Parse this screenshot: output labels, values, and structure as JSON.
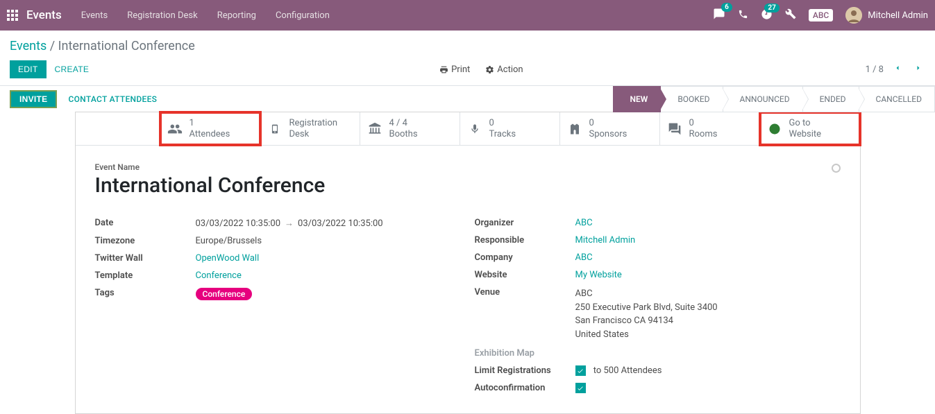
{
  "topbar": {
    "brand": "Events",
    "menu": [
      "Events",
      "Registration Desk",
      "Reporting",
      "Configuration"
    ],
    "msg_badge": "6",
    "activity_badge": "27",
    "company": "ABC",
    "user": "Mitchell Admin"
  },
  "breadcrumb": {
    "root": "Events",
    "current": "International Conference"
  },
  "actions": {
    "edit": "EDIT",
    "create": "CREATE",
    "print": "Print",
    "action": "Action"
  },
  "pager": {
    "pos": "1 / 8"
  },
  "statusbar": {
    "invite": "INVITE",
    "contact": "CONTACT ATTENDEES",
    "stages": [
      "NEW",
      "BOOKED",
      "ANNOUNCED",
      "ENDED",
      "CANCELLED"
    ]
  },
  "stats": {
    "attendees": {
      "n": "1",
      "label": "Attendees"
    },
    "regdesk": {
      "n": "",
      "label1": "Registration",
      "label2": "Desk"
    },
    "booths": {
      "n": "4 / 4",
      "label": "Booths"
    },
    "tracks": {
      "n": "0",
      "label": "Tracks"
    },
    "sponsors": {
      "n": "0",
      "label": "Sponsors"
    },
    "rooms": {
      "n": "0",
      "label": "Rooms"
    },
    "website": {
      "label1": "Go to",
      "label2": "Website"
    }
  },
  "form": {
    "name_label": "Event Name",
    "name": "International Conference",
    "date_label": "Date",
    "date_from": "03/03/2022 10:35:00",
    "date_to": "03/03/2022 10:35:00",
    "tz_label": "Timezone",
    "tz": "Europe/Brussels",
    "twitter_label": "Twitter Wall",
    "twitter": "OpenWood Wall",
    "template_label": "Template",
    "template": "Conference",
    "tags_label": "Tags",
    "tag": "Conference",
    "organizer_label": "Organizer",
    "organizer": "ABC",
    "responsible_label": "Responsible",
    "responsible": "Mitchell Admin",
    "company_label": "Company",
    "company": "ABC",
    "website_label": "Website",
    "website": "My Website",
    "venue_label": "Venue",
    "venue_name": "ABC",
    "venue_street": "250 Executive Park Blvd, Suite 3400",
    "venue_city": "San Francisco CA 94134",
    "venue_country": "United States",
    "map_label": "Exhibition Map",
    "limit_label": "Limit Registrations",
    "limit_val": "to 500 Attendees",
    "autoconf_label": "Autoconfirmation"
  }
}
